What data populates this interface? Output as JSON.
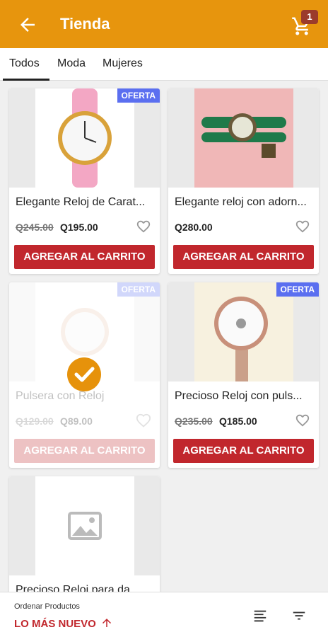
{
  "appbar": {
    "title": "Tienda",
    "cart_count": "1"
  },
  "tabs": [
    {
      "label": "Todos"
    },
    {
      "label": "Moda"
    },
    {
      "label": "Mujeres"
    }
  ],
  "products": [
    {
      "name": "Elegante Reloj de Carat...",
      "price_old": "Q245.00",
      "price_new": "Q195.00",
      "offer": "OFERTA",
      "button": "AGREGAR AL CARRITO"
    },
    {
      "name": "Elegante reloj con adorn...",
      "price_old": "",
      "price_new": "Q280.00",
      "offer": "",
      "button": "AGREGAR AL CARRITO"
    },
    {
      "name": "Pulsera con Reloj",
      "price_old": "Q129.00",
      "price_new": "Q89.00",
      "offer": "OFERTA",
      "button": "AGREGAR AL CARRITO"
    },
    {
      "name": "Precioso Reloj con puls...",
      "price_old": "Q235.00",
      "price_new": "Q185.00",
      "offer": "OFERTA",
      "button": "AGREGAR AL CARRITO"
    },
    {
      "name": "Precioso Reloj para da...",
      "price_old": "",
      "price_new": "",
      "offer": "",
      "button": ""
    }
  ],
  "sortbar": {
    "label": "Ordenar Productos",
    "value": "LO MÁS NUEVO"
  },
  "colors": {
    "primary": "#e7950d",
    "button": "#c1272d",
    "offer": "#5b6ff0"
  }
}
